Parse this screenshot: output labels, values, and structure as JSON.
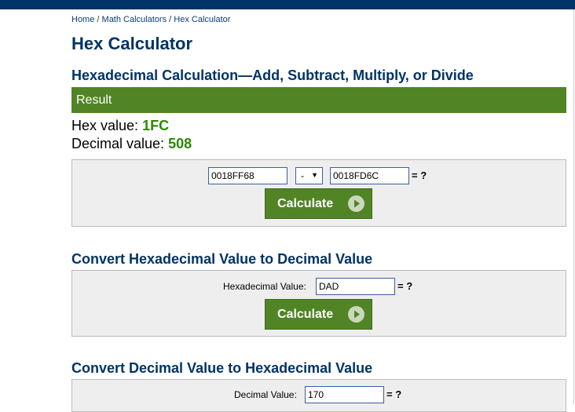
{
  "breadcrumb": {
    "home": "Home",
    "sep": "/",
    "math": "Math Calculators",
    "current": "Hex Calculator"
  },
  "page_title": "Hex Calculator",
  "section1": {
    "title": "Hexadecimal Calculation—Add, Subtract, Multiply, or Divide",
    "result_header": "Result",
    "hex_label": "Hex value:",
    "hex_value": "1FC",
    "dec_label": "Decimal value:",
    "dec_value": "508",
    "input1": "0018FF68",
    "operator": "-",
    "input2": "0018FD6C",
    "eq": "= ?",
    "button": "Calculate"
  },
  "section2": {
    "title": "Convert Hexadecimal Value to Decimal Value",
    "label": "Hexadecimal Value:",
    "input": "DAD",
    "eq": "= ?",
    "button": "Calculate"
  },
  "section3": {
    "title": "Convert Decimal Value to Hexadecimal Value",
    "label": "Decimal Value:",
    "input": "170",
    "eq": "= ?"
  },
  "colors": {
    "header": "#003366",
    "accent_green": "#518425",
    "value_green": "#2a8a00"
  },
  "icons": {
    "calculate_button": "play-circle-icon",
    "select": "triangle-down-icon"
  }
}
